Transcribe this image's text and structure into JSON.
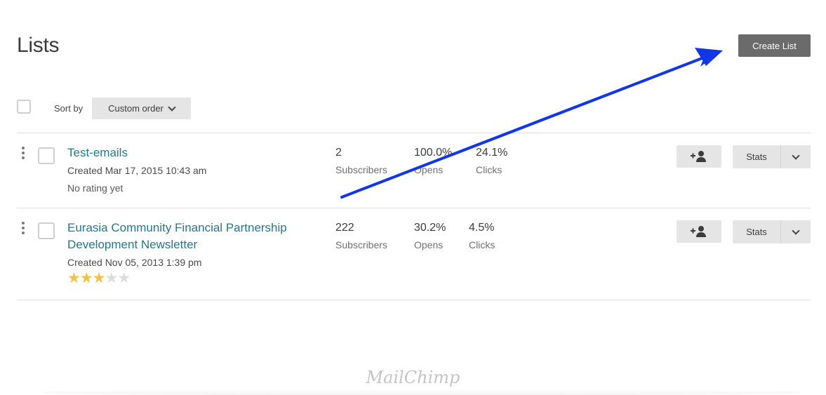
{
  "page": {
    "title": "Lists",
    "create_button": "Create List"
  },
  "toolbar": {
    "sort_label": "Sort by",
    "sort_value": "Custom order"
  },
  "lists": [
    {
      "name": "Test-emails",
      "created": "Created Mar 17, 2015 10:43 am",
      "rating_text": "No rating yet",
      "subscribers": "2",
      "subscribers_label": "Subscribers",
      "opens": "100.0%",
      "opens_label": "Opens",
      "clicks": "24.1%",
      "clicks_label": "Clicks",
      "stats_button": "Stats"
    },
    {
      "name_line1": "Eurasia Community Financial Partnership",
      "name_line2": "Development Newsletter",
      "created": "Created Nov 05, 2013 1:39 pm",
      "rating": 3,
      "rating_max": 5,
      "subscribers": "222",
      "subscribers_label": "Subscribers",
      "opens": "30.2%",
      "opens_label": "Opens",
      "clicks": "4.5%",
      "clicks_label": "Clicks",
      "stats_button": "Stats"
    }
  ],
  "footer": {
    "logo_text": "MailChimp"
  },
  "colors": {
    "link": "#23798a",
    "annotation_arrow": "#1036e8",
    "star_on": "#f5c044",
    "star_off": "#dcdcdc"
  },
  "icons": {
    "add_subscriber": "add-user-icon",
    "dropdown": "chevron-down-icon",
    "drag": "drag-handle-icon",
    "star": "star-icon"
  }
}
